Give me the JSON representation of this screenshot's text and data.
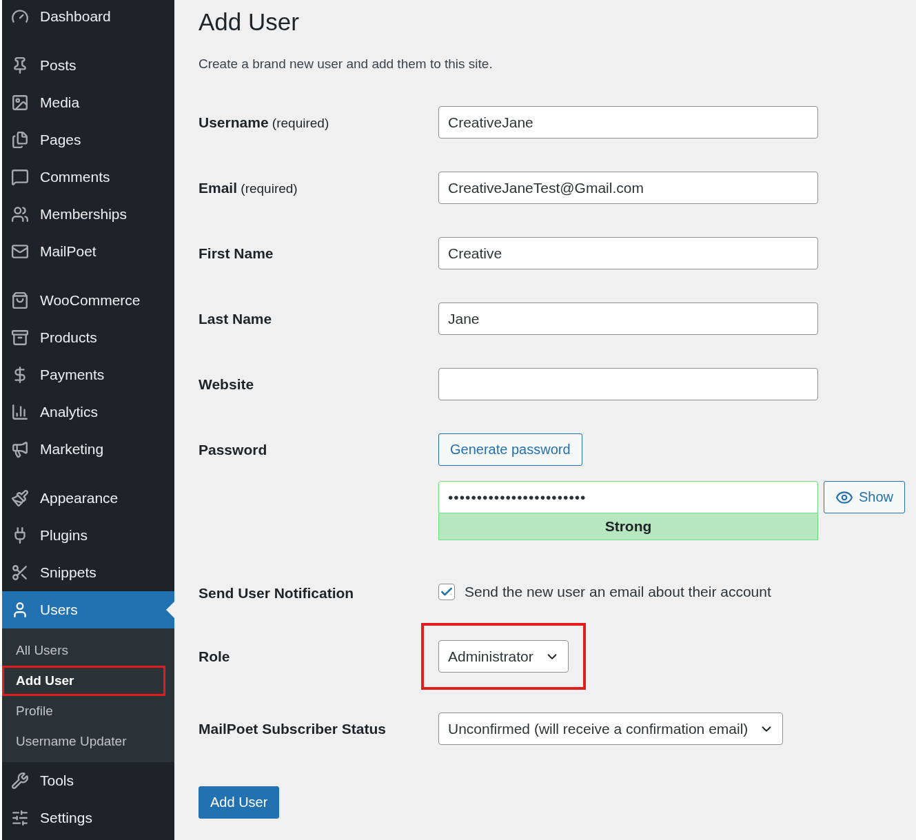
{
  "sidebar": {
    "groups": [
      {
        "items": [
          {
            "label": "Dashboard",
            "selected": false
          }
        ]
      },
      {
        "items": [
          {
            "label": "Posts",
            "selected": false
          },
          {
            "label": "Media",
            "selected": false
          },
          {
            "label": "Pages",
            "selected": false
          },
          {
            "label": "Comments",
            "selected": false
          },
          {
            "label": "Memberships",
            "selected": false
          },
          {
            "label": "MailPoet",
            "selected": false
          }
        ]
      },
      {
        "items": [
          {
            "label": "WooCommerce",
            "selected": false
          },
          {
            "label": "Products",
            "selected": false
          },
          {
            "label": "Payments",
            "selected": false
          },
          {
            "label": "Analytics",
            "selected": false
          },
          {
            "label": "Marketing",
            "selected": false
          }
        ]
      },
      {
        "items": [
          {
            "label": "Appearance",
            "selected": false
          },
          {
            "label": "Plugins",
            "selected": false
          },
          {
            "label": "Snippets",
            "selected": false
          },
          {
            "label": "Users",
            "selected": true,
            "children": [
              {
                "label": "All Users",
                "selected": false,
                "highlighted": false
              },
              {
                "label": "Add User",
                "selected": true,
                "highlighted": true
              },
              {
                "label": "Profile",
                "selected": false,
                "highlighted": false
              },
              {
                "label": "Username Updater",
                "selected": false,
                "highlighted": false
              }
            ]
          },
          {
            "label": "Tools",
            "selected": false
          },
          {
            "label": "Settings",
            "selected": false
          }
        ]
      }
    ]
  },
  "page": {
    "title": "Add User",
    "description": "Create a brand new user and add them to this site."
  },
  "form": {
    "rows": [
      {
        "kind": "text",
        "label": "Username",
        "note": "(required)",
        "value": "CreativeJane"
      },
      {
        "kind": "text",
        "label": "Email",
        "note": "(required)",
        "value": "CreativeJaneTest@Gmail.com"
      },
      {
        "kind": "text",
        "label": "First Name",
        "value": "Creative"
      },
      {
        "kind": "text",
        "label": "Last Name",
        "value": "Jane"
      },
      {
        "kind": "text",
        "label": "Website"
      },
      {
        "kind": "password",
        "label": "Password",
        "generate_button": "Generate password",
        "value": "••••••••••••••••••••••••",
        "show_button": "Show",
        "strength": "Strong"
      },
      {
        "kind": "checkbox",
        "label": "Send User Notification",
        "checked": true,
        "text": "Send the new user an email about their account"
      },
      {
        "kind": "select",
        "label": "Role",
        "value": "Administrator",
        "highlighted": true
      },
      {
        "kind": "select",
        "label": "MailPoet Subscriber Status",
        "value": "Unconfirmed (will receive a confirmation email)",
        "highlighted": false
      }
    ],
    "submit": "Add User"
  }
}
